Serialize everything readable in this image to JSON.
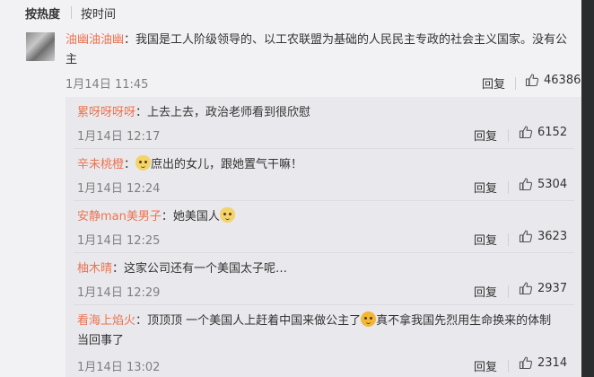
{
  "sort": {
    "hot": "按热度",
    "time": "按时间"
  },
  "main": {
    "user": "油幽油油幽",
    "text_line1": "：我国是工人阶级领导的、以工农联盟为基础的人民民主专政的社会主义国家。没有公",
    "text_line2": "主",
    "time": "1月14日 11:45",
    "reply_label": "回复",
    "likes": "46386"
  },
  "replies": [
    {
      "user": "累呀呀呀呀",
      "text": "：上去上去，政治老师看到很欣慰",
      "time": "1月14日 12:17",
      "reply_label": "回复",
      "likes": "6152"
    },
    {
      "user": "辛未桃橙",
      "text_before": "：",
      "emoji": "doge-emoji",
      "text_after": "庶出的女儿，跟她置气干嘛！",
      "time": "1月14日 12:24",
      "reply_label": "回复",
      "likes": "5304"
    },
    {
      "user": "安静man美男子",
      "text_before": "：她美国人",
      "emoji": "doge-emoji",
      "time": "1月14日 12:25",
      "reply_label": "回复",
      "likes": "3623"
    },
    {
      "user": "柚木晴",
      "text": "：这家公司还有一个美国太子呢…",
      "time": "1月14日 12:29",
      "reply_label": "回复",
      "likes": "2937"
    },
    {
      "user": "看海上焰火",
      "text_before": "：顶顶顶 一个美国人上赶着中国来做公主了",
      "emoji": "grin-emoji",
      "text_after": "真不拿我国先烈用生命换来的体制",
      "text_line2": "当回事了",
      "time": "1月14日 13:02",
      "reply_label": "回复",
      "likes": "2314"
    }
  ]
}
